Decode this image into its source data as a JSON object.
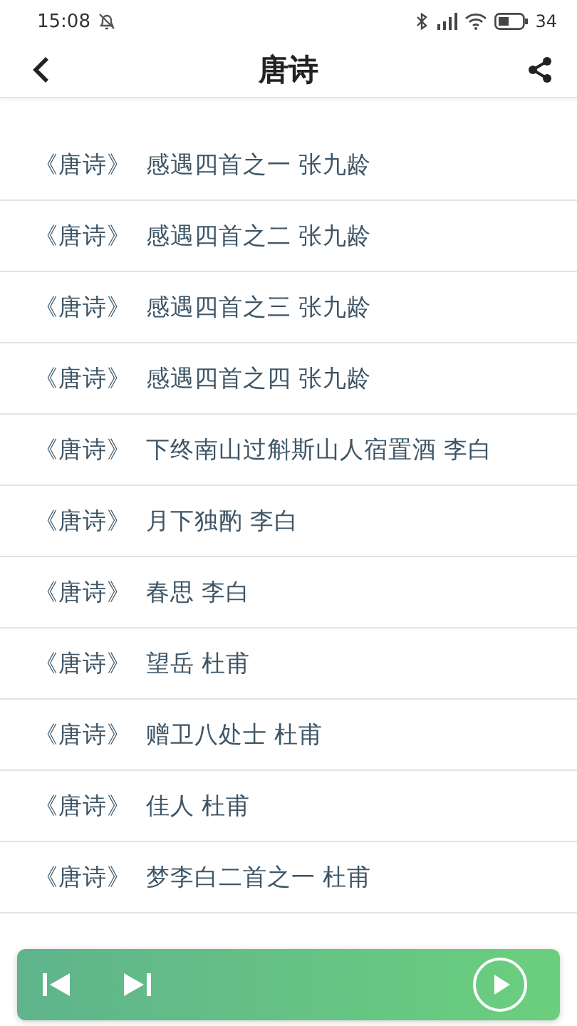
{
  "status_bar": {
    "time": "15:08",
    "battery": "34"
  },
  "header": {
    "title": "唐诗"
  },
  "poems": [
    {
      "book": "《唐诗》",
      "title": "感遇四首之一 张九龄"
    },
    {
      "book": "《唐诗》",
      "title": "感遇四首之二 张九龄"
    },
    {
      "book": "《唐诗》",
      "title": "感遇四首之三 张九龄"
    },
    {
      "book": "《唐诗》",
      "title": "感遇四首之四 张九龄"
    },
    {
      "book": "《唐诗》",
      "title": "下终南山过斛斯山人宿置酒 李白"
    },
    {
      "book": "《唐诗》",
      "title": "月下独酌 李白"
    },
    {
      "book": "《唐诗》",
      "title": "春思 李白"
    },
    {
      "book": "《唐诗》",
      "title": "望岳 杜甫"
    },
    {
      "book": "《唐诗》",
      "title": "赠卫八处士 杜甫"
    },
    {
      "book": "《唐诗》",
      "title": "佳人 杜甫"
    },
    {
      "book": "《唐诗》",
      "title": "梦李白二首之一 杜甫"
    }
  ]
}
